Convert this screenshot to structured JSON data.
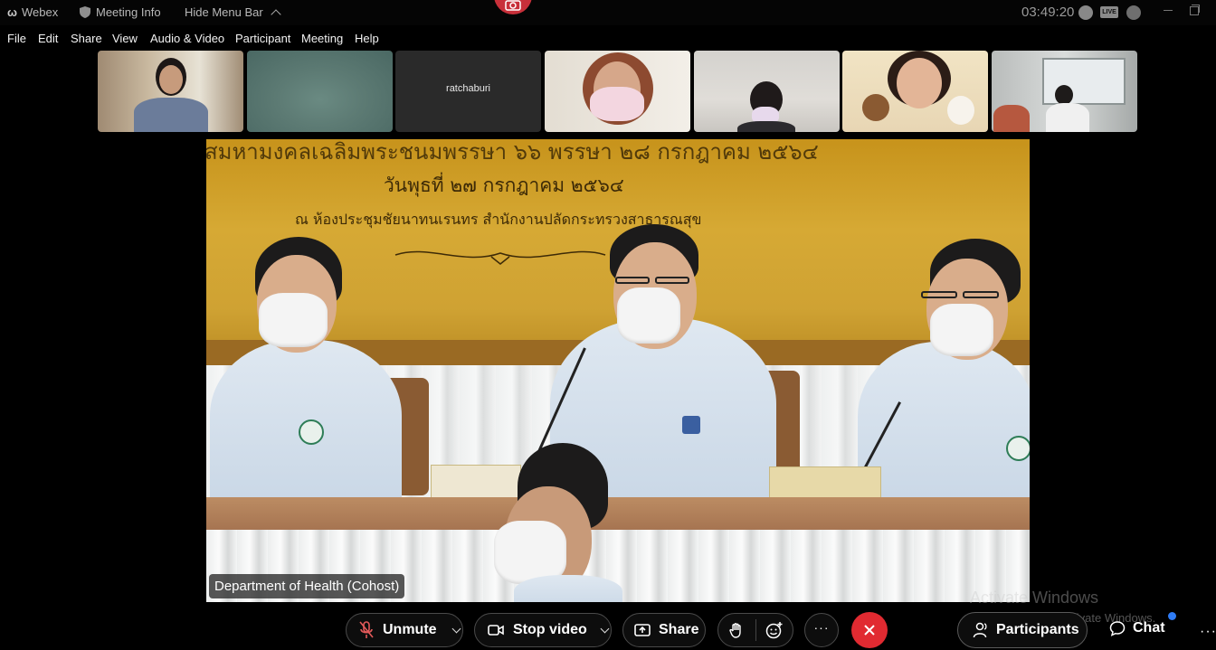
{
  "titlebar": {
    "app_name": "Webex",
    "meeting_info": "Meeting Info",
    "hide_menu_bar": "Hide Menu Bar",
    "clock": "03:49:20",
    "live_badge": "LIVE"
  },
  "menu": {
    "items": [
      "File",
      "Edit",
      "Share",
      "View",
      "Audio & Video",
      "Participant",
      "Meeting",
      "Help"
    ]
  },
  "thumbnails": [
    {
      "name": ""
    },
    {
      "name": ""
    },
    {
      "name": "ratchaburi"
    },
    {
      "name": ""
    },
    {
      "name": ""
    },
    {
      "name": ""
    },
    {
      "name": ""
    }
  ],
  "main_video": {
    "speaker_label": "Department of Health (Cohost)",
    "banner_line1": "สมหามงคลเฉลิมพระชนมพรรษา ๖๖ พรรษา ๒๘ กรกฎาคม ๒๕๖๔",
    "banner_line2": "วันพุธที่ ๒๗ กรกฎาคม ๒๕๖๔",
    "banner_line3": "ณ ห้องประชุมชัยนาทนเรนทร สำนักงานปลัดกระทรวงสาธารณสุข"
  },
  "controls": {
    "unmute": "Unmute",
    "stop_video": "Stop video",
    "share": "Share",
    "more": "···",
    "participants": "Participants",
    "chat": "Chat",
    "more_right": "···"
  },
  "watermark": {
    "title": "Activate Windows",
    "subtitle": "Go to Settings to activate Windows."
  },
  "colors": {
    "end_meeting": "#e12a31",
    "notification": "#2f7cf5",
    "recording": "#c8303a"
  }
}
